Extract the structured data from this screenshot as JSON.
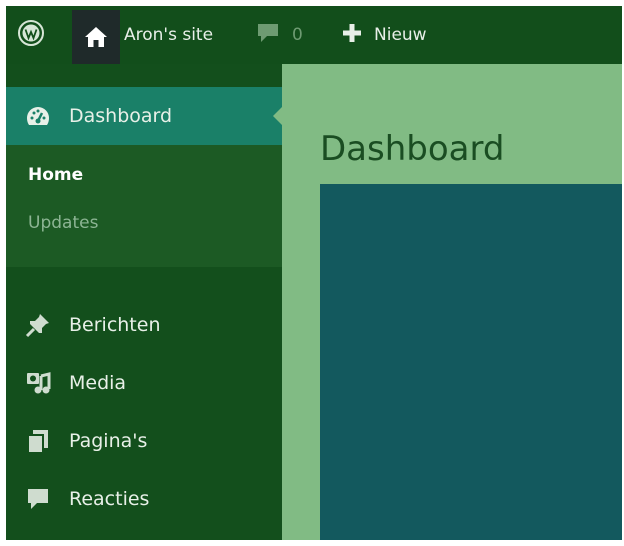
{
  "adminbar": {
    "site_name": "Aron's site",
    "comments_count": "0",
    "new_label": "Nieuw",
    "icons": {
      "logo": "wordpress-logo-icon",
      "home": "home-icon",
      "comments": "comment-bubble-icon",
      "new": "plus-icon"
    }
  },
  "sidebar": {
    "dashboard_label": "Dashboard",
    "submenu": {
      "home_label": "Home",
      "updates_label": "Updates"
    },
    "items": [
      {
        "label": "Berichten",
        "icon": "pushpin-icon"
      },
      {
        "label": "Media",
        "icon": "media-icon"
      },
      {
        "label": "Pagina's",
        "icon": "pages-icon"
      },
      {
        "label": "Reacties",
        "icon": "comment-icon"
      }
    ]
  },
  "main": {
    "title": "Dashboard"
  },
  "colors": {
    "adminbar_bg": "#124e1b",
    "sidebar_bg": "#134f1c",
    "active_menu_bg": "#1a8068",
    "submenu_bg": "#1c5a24",
    "content_bg": "#81bb84",
    "panel_bg": "#13595e"
  }
}
